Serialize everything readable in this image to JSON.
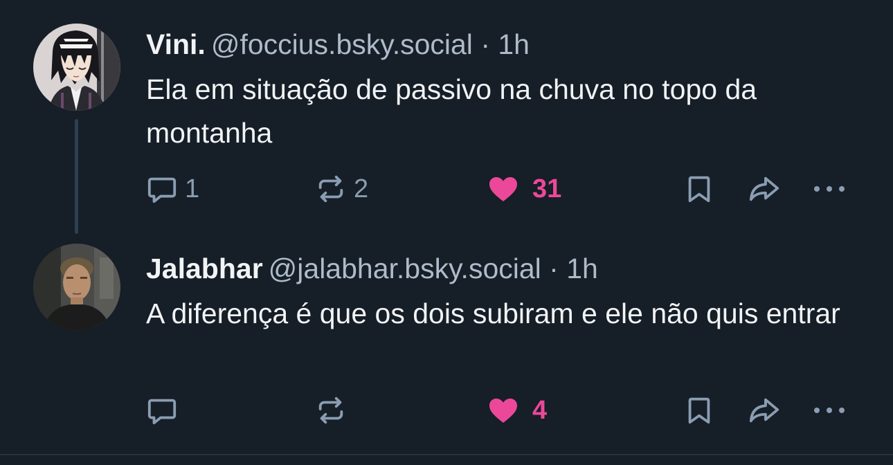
{
  "posts": [
    {
      "author": {
        "name": "Vini.",
        "handle": "@foccius.bsky.social",
        "avatar_icon": "anime-avatar"
      },
      "separator": " · ",
      "time": "1h",
      "text": "Ela em situação de passivo na chuva no topo da montanha",
      "actions": {
        "reply_count": "1",
        "repost_count": "2",
        "like_count": "31",
        "liked": true
      }
    },
    {
      "author": {
        "name": "Jalabhar",
        "handle": "@jalabhar.bsky.social",
        "avatar_icon": "photo-avatar"
      },
      "separator": " · ",
      "time": "1h",
      "text": "A diferença é que os dois subiram e ele não quis entrar",
      "actions": {
        "reply_count": "",
        "repost_count": "",
        "like_count": "4",
        "liked": true
      }
    }
  ],
  "colors": {
    "background": "#161e27",
    "text": "#f1f3f5",
    "muted": "#aebbc9",
    "icon": "#8a9db2",
    "like": "#ec4899",
    "thread_line": "#2e4052"
  }
}
